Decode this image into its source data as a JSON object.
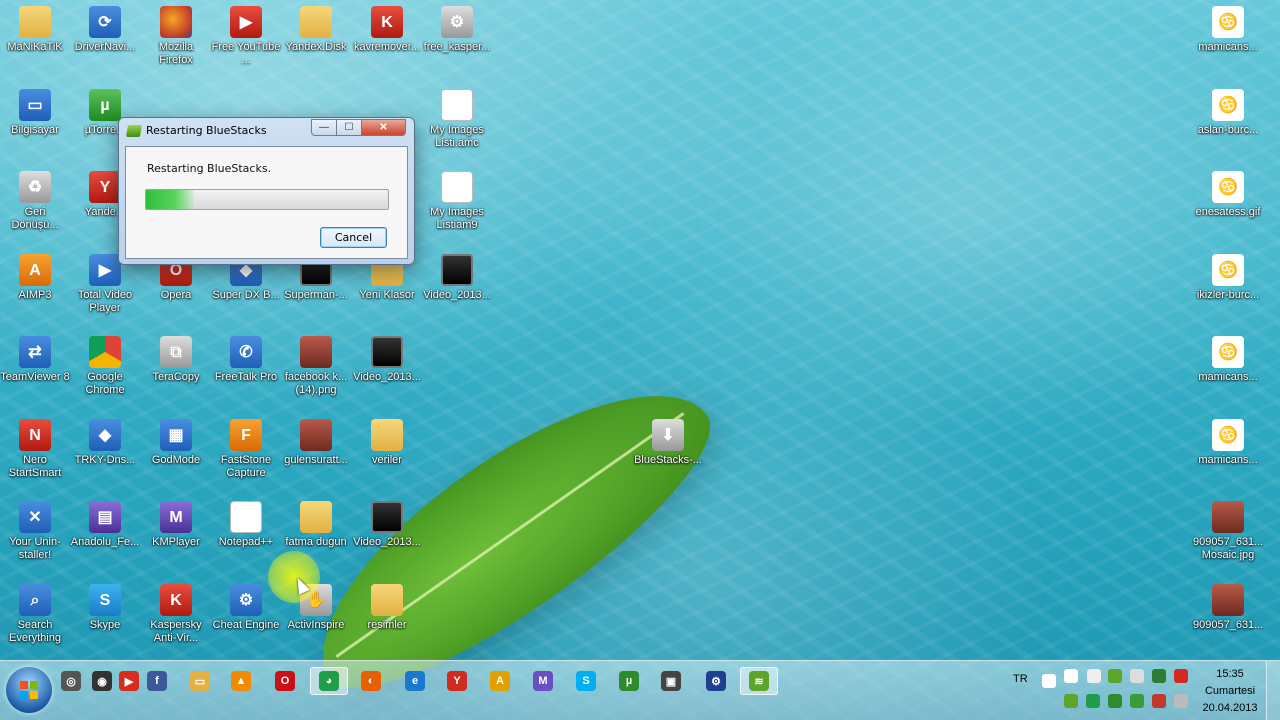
{
  "desktop": {
    "icons": [
      {
        "label": "MaNiKaTiK",
        "icon": "folder-icon"
      },
      {
        "label": "DriverNavi...",
        "icon": "driver-icon"
      },
      {
        "label": "Mozilla Firefox",
        "icon": "firefox-icon"
      },
      {
        "label": "Free YouTube ...",
        "icon": "youtube-download-icon"
      },
      {
        "label": "Yandex.Disk",
        "icon": "folder-icon"
      },
      {
        "label": "kavremover...",
        "icon": "kaspersky-icon"
      },
      {
        "label": "free_kasper...",
        "icon": "settings-icon"
      },
      {
        "label": "mamicans...",
        "icon": "zodiac-icon"
      },
      {
        "label": "Bilgisayar",
        "icon": "computer-icon"
      },
      {
        "label": "µTorre...",
        "icon": "utorrent-icon"
      },
      {
        "label": "My Images Listi.amc",
        "icon": "file-icon"
      },
      {
        "label": "aslan-burc...",
        "icon": "zodiac-icon"
      },
      {
        "label": "Geri Dönüşü...",
        "icon": "recycle-bin-icon"
      },
      {
        "label": "Yande...",
        "icon": "yandex-icon"
      },
      {
        "label": "My Images Listiam9",
        "icon": "file-icon"
      },
      {
        "label": "enesatess.gif",
        "icon": "zodiac-icon"
      },
      {
        "label": "AIMP3",
        "icon": "aimp-icon"
      },
      {
        "label": "Total Video Player",
        "icon": "video-player-icon"
      },
      {
        "label": "Opera",
        "icon": "opera-icon"
      },
      {
        "label": "Super DX B...",
        "icon": "app-icon"
      },
      {
        "label": "Superman-...",
        "icon": "video-icon"
      },
      {
        "label": "Yeni Klasör",
        "icon": "folder-icon"
      },
      {
        "label": "Video_2013...",
        "icon": "video-icon"
      },
      {
        "label": "ikizler-burc...",
        "icon": "zodiac-icon"
      },
      {
        "label": "TeamViewer 8",
        "icon": "teamviewer-icon"
      },
      {
        "label": "Google Chrome",
        "icon": "chrome-icon"
      },
      {
        "label": "TeraCopy",
        "icon": "teracopy-icon"
      },
      {
        "label": "FreeTalk Pro",
        "icon": "freetalk-icon"
      },
      {
        "label": "facebook k... (14).png",
        "icon": "image-icon"
      },
      {
        "label": "Video_2013...",
        "icon": "video-icon"
      },
      {
        "label": "mamicans...",
        "icon": "zodiac-icon"
      },
      {
        "label": "Nero StartSmart",
        "icon": "nero-icon"
      },
      {
        "label": "TRKY-Dns...",
        "icon": "app-icon"
      },
      {
        "label": "GodMode",
        "icon": "control-panel-icon"
      },
      {
        "label": "FastStone Capture",
        "icon": "faststone-icon"
      },
      {
        "label": "gulensuratt...",
        "icon": "image-icon"
      },
      {
        "label": "veriler",
        "icon": "folder-icon"
      },
      {
        "label": "BlueStacks-...",
        "icon": "installer-icon"
      },
      {
        "label": "mamicans...",
        "icon": "zodiac-icon"
      },
      {
        "label": "Your Unin-staller!",
        "icon": "uninstaller-icon"
      },
      {
        "label": "Anadolu_Fe...",
        "icon": "archive-icon"
      },
      {
        "label": "KMPlayer",
        "icon": "kmplayer-icon"
      },
      {
        "label": "Notepad++",
        "icon": "notepad-icon"
      },
      {
        "label": "fatma dugun",
        "icon": "folder-icon"
      },
      {
        "label": "Video_2013...",
        "icon": "video-icon"
      },
      {
        "label": "909057_631... Mosaic.jpg",
        "icon": "photo-icon"
      },
      {
        "label": "Search Everything",
        "icon": "search-icon"
      },
      {
        "label": "Skype",
        "icon": "skype-icon"
      },
      {
        "label": "Kaspersky Anti-Vir...",
        "icon": "kaspersky-icon"
      },
      {
        "label": "Cheat Engine",
        "icon": "cheat-engine-icon"
      },
      {
        "label": "ActivInspire",
        "icon": "activinspire-icon"
      },
      {
        "label": "resimler",
        "icon": "folder-icon"
      },
      {
        "label": "909057_631...",
        "icon": "photo-icon"
      }
    ]
  },
  "dialog": {
    "title": "Restarting BlueStacks",
    "message": "Restarting BlueStacks.",
    "progress_fraction": 0.2,
    "cancel_label": "Cancel",
    "min_glyph": "—",
    "max_glyph": "☐",
    "close_glyph": "✕"
  },
  "taskbar": {
    "language": "TR",
    "time": "15:35",
    "day": "Cumartesi",
    "date": "20.04.2013",
    "pinned": [
      {
        "name": "rocketdock-icon",
        "glyph": "◎",
        "color": "#555555"
      },
      {
        "name": "webcam-icon",
        "glyph": "◉",
        "color": "#333333"
      },
      {
        "name": "youtube-icon",
        "glyph": "▶",
        "color": "#d62d20"
      },
      {
        "name": "facebook-icon",
        "glyph": "f",
        "color": "#3b5998"
      },
      {
        "name": "explorer-icon",
        "glyph": "▭",
        "color": "#e1b143"
      },
      {
        "name": "vlc-icon",
        "glyph": "▲",
        "color": "#f08a00"
      },
      {
        "name": "opera-icon",
        "glyph": "O",
        "color": "#cc0f16"
      },
      {
        "name": "chrome-icon",
        "glyph": "◕",
        "color": "#1e9e4a"
      },
      {
        "name": "firefox-icon",
        "glyph": "◐",
        "color": "#e66000"
      },
      {
        "name": "ie-icon",
        "glyph": "e",
        "color": "#1b78d0"
      },
      {
        "name": "yandex-icon",
        "glyph": "Y",
        "color": "#d12a1f"
      },
      {
        "name": "aimp-icon",
        "glyph": "A",
        "color": "#e0a000"
      },
      {
        "name": "kmplayer-icon",
        "glyph": "M",
        "color": "#6a4fc2"
      },
      {
        "name": "skype-icon",
        "glyph": "S",
        "color": "#00aff0"
      },
      {
        "name": "utorrent-icon",
        "glyph": "µ",
        "color": "#2e8b2e"
      },
      {
        "name": "camera-app-icon",
        "glyph": "▣",
        "color": "#444444"
      },
      {
        "name": "cheat-engine-icon",
        "glyph": "⚙",
        "color": "#1f3f8f"
      },
      {
        "name": "bluestacks-icon",
        "glyph": "≋",
        "color": "#5ba62a"
      }
    ]
  }
}
